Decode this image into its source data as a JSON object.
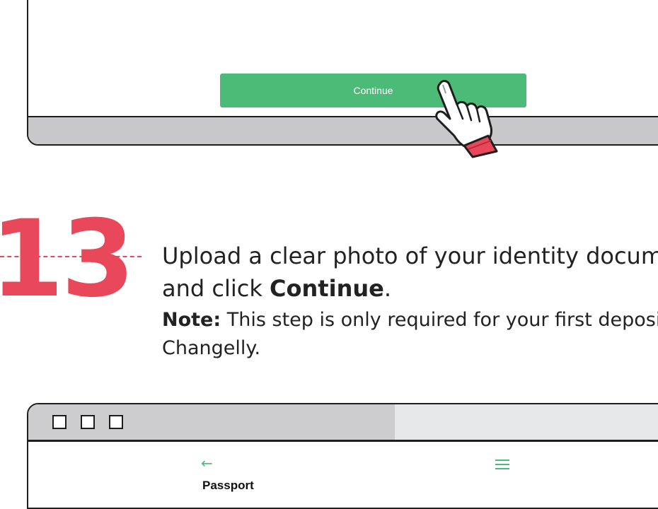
{
  "top_mockup": {
    "continue_label": "Continue",
    "accent": "#4cbb78"
  },
  "step": {
    "number": "13",
    "text_before": "Upload a clear photo of your identity document",
    "text_line2_prefix": "and click ",
    "text_bold": "Continue",
    "text_end": ".",
    "note_label": "Note:",
    "note_text": " This step is only required for your first deposit on",
    "note_line2": "Changelly.",
    "accent": "#e8485a"
  },
  "bottom_mockup": {
    "back_icon": "arrow-left-icon",
    "menu_icon": "hamburger-menu-icon",
    "page_title": "Passport"
  }
}
